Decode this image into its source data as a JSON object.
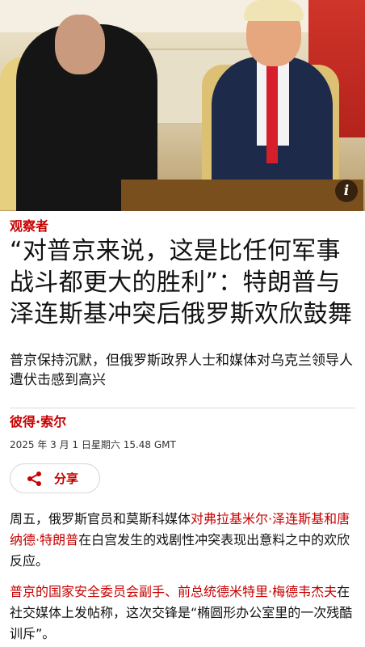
{
  "hero": {
    "info_icon": "info-icon",
    "info_label": "i"
  },
  "article": {
    "section": "观察者",
    "headline": "“对普京来说，这是比任何军事战斗都更大的胜利”：特朗普与泽连斯基冲突后俄罗斯欢欣鼓舞",
    "standfirst": "普京保持沉默，但俄罗斯政界人士和媒体对乌克兰领导人遭伏击感到高兴",
    "author": "彼得·索尔",
    "date": "2025 年 3 月 1 日星期六 15.48 GMT",
    "share": {
      "icon": "share-icon",
      "label": "分享"
    },
    "paragraph1": {
      "text_before": "周五，俄罗斯官员和莫斯科媒体",
      "link": "对弗拉基米尔·泽连斯基和唐纳德·特朗普",
      "text_after": "在白宫发生的戏剧性冲突表现出意料之中的欢欣反应。"
    },
    "paragraph2": {
      "link": "普京的国家安全委员会副手、前总统德米特里·梅德韦杰夫",
      "text_after": "在社交媒体上发帖称，这次交锋是“椭圆形办公室里的一次残酷训斥”。"
    }
  },
  "colors": {
    "accent": "#c70000",
    "text": "#121212"
  }
}
